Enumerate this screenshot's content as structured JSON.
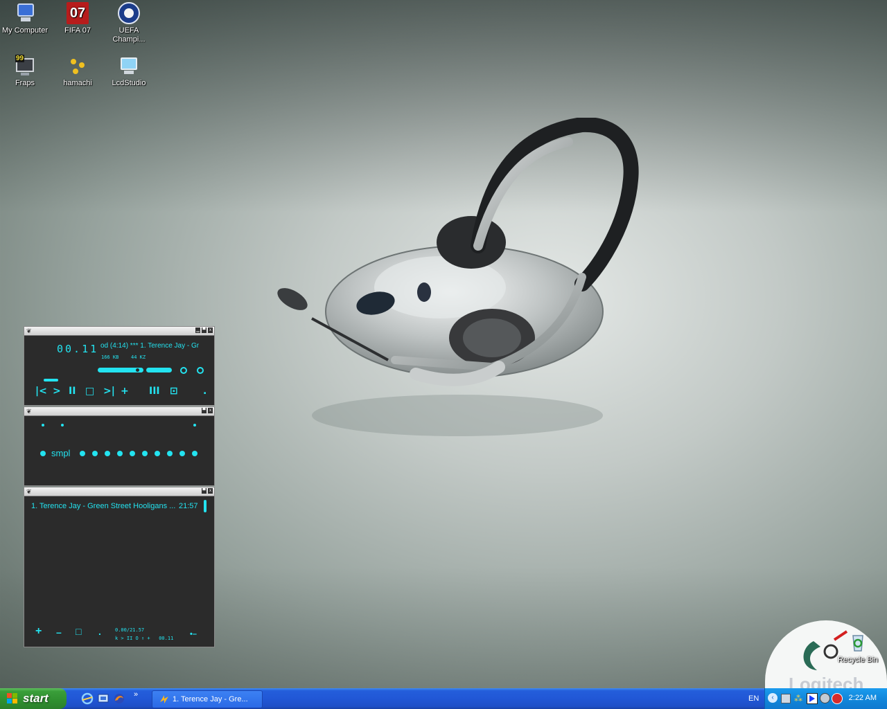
{
  "desktop": {
    "icons": [
      {
        "label": "My Computer",
        "icon": "my-computer-icon"
      },
      {
        "label": "FIFA 07",
        "icon": "fifa07-icon",
        "badge": "07"
      },
      {
        "label": "UEFA Champi...",
        "icon": "uefa-icon"
      },
      {
        "label": "Fraps",
        "icon": "fraps-icon",
        "badge": "99"
      },
      {
        "label": "hamachi",
        "icon": "hamachi-icon"
      },
      {
        "label": "LcdStudio",
        "icon": "lcdstudio-icon"
      },
      {
        "label": "Recycle Bin",
        "icon": "recycle-bin-icon"
      }
    ],
    "wallpaper_brand": "Logitech",
    "accent": "#23e3f0"
  },
  "winamp": {
    "main": {
      "time": "00.11",
      "marquee": "od (4:14) *** 1. Terence Jay - Gr",
      "kbps": "166 KB",
      "khz": "44 KZ",
      "controls": [
        "prev",
        "play",
        "pause",
        "stop",
        "next",
        "eject",
        "bars",
        "loop",
        "dot"
      ]
    },
    "eq": {
      "label": "smpl"
    },
    "playlist": {
      "items": [
        {
          "title": "1. Terence Jay - Green Street Hooligans ...",
          "duration": "21:57"
        }
      ],
      "bottom_buttons": [
        "+",
        "–",
        "□",
        "."
      ],
      "status_time": "0.00/21.57",
      "status_controls": "k > II O ↑ +   00.11",
      "tail": "•–"
    }
  },
  "taskbar": {
    "start_label": "start",
    "task": "1. Terence Jay - Gre...",
    "lang": "EN",
    "clock": "2:22 AM"
  }
}
